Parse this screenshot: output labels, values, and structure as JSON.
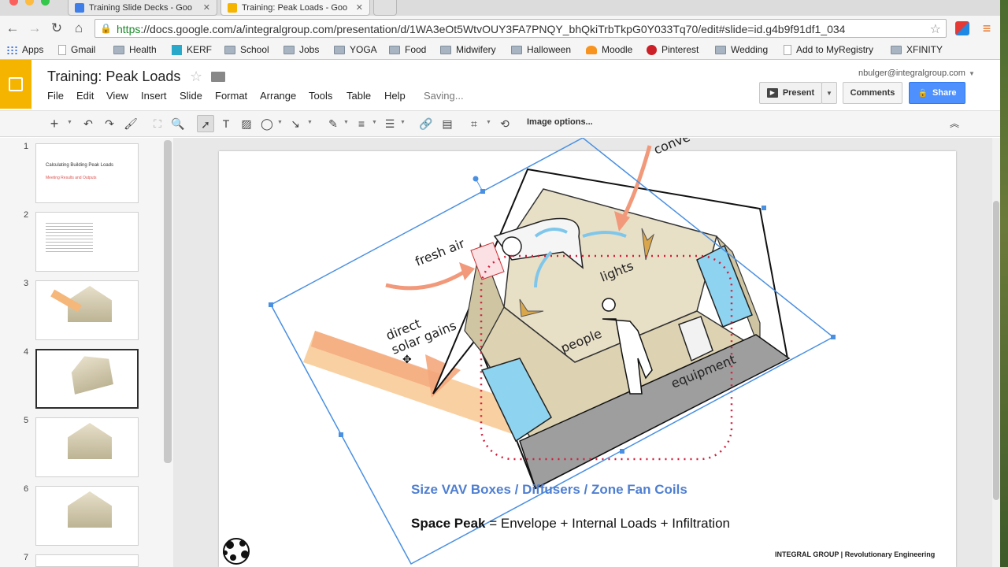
{
  "browser": {
    "tabs": [
      {
        "title": "Training Slide Decks - Goo",
        "favicon_color": "#3f7ee8"
      },
      {
        "title": "Training: Peak Loads - Goo",
        "favicon_color": "#f4b400"
      }
    ],
    "url_scheme": "https",
    "url_rest": "://docs.google.com/a/integralgroup.com/presentation/d/1WA3eOt5WtvOUY3FA7PNQY_bhQkiTrbTkpG0Y033Tq70/edit#slide=id.g4b9f91df1_034",
    "bookmarks": [
      "Apps",
      "Gmail",
      "Health",
      "KERF",
      "School",
      "Jobs",
      "YOGA",
      "Food",
      "Midwifery",
      "Halloween",
      "Moodle",
      "Pinterest",
      "Wedding",
      "Add to MyRegistry",
      "XFINITY"
    ]
  },
  "app": {
    "title": "Training: Peak Loads",
    "menu": [
      "File",
      "Edit",
      "View",
      "Insert",
      "Slide",
      "Format",
      "Arrange",
      "Tools",
      "Table",
      "Help"
    ],
    "status": "Saving...",
    "account": "nbulger@integralgroup.com",
    "present_label": "Present",
    "comments_label": "Comments",
    "share_label": "Share",
    "accent_color": "#4d90fe",
    "logo_color": "#f4b400"
  },
  "toolbar": {
    "image_options_label": "Image options..."
  },
  "filmstrip": {
    "numbers": [
      "1",
      "2",
      "3",
      "4",
      "5",
      "6",
      "7"
    ],
    "thumb1_title": "Calculating Building Peak Loads",
    "thumb1_sub": "Meeting Results and Outputs",
    "selected_index": 4
  },
  "slide": {
    "diagram_labels": {
      "fresh_air": "fresh air",
      "direct": "direct",
      "solar_gains": "solar gains",
      "lights": "lights",
      "people": "people",
      "equipment": "equipment",
      "convection": "conve"
    },
    "subtitle": "Size VAV Boxes / Diffusers / Zone Fan Coils",
    "equation_bold": "Space Peak",
    "equation_rest": " = Envelope + Internal Loads + Infiltration",
    "footer": "INTEGRAL GROUP | Revolutionary Engineering"
  }
}
